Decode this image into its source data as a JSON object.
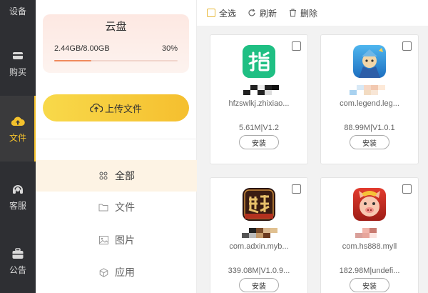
{
  "nav": {
    "items": [
      {
        "label": "设备",
        "icon": "device-icon"
      },
      {
        "label": "购买",
        "icon": "wallet-icon"
      },
      {
        "label": "文件",
        "icon": "cloud-upload-icon",
        "active": true
      },
      {
        "label": "客服",
        "icon": "headset-icon"
      },
      {
        "label": "公告",
        "icon": "briefcase-icon"
      }
    ]
  },
  "cloud": {
    "title": "云盘",
    "usage": "2.44GB/8.00GB",
    "percent_label": "30%",
    "percent": 0.3
  },
  "upload": {
    "label": "上传文件"
  },
  "categories": [
    {
      "label": "全部",
      "icon": "grid-icon",
      "active": true
    },
    {
      "label": "文件",
      "icon": "folder-icon"
    },
    {
      "label": "图片",
      "icon": "image-icon"
    },
    {
      "label": "应用",
      "icon": "app-icon"
    }
  ],
  "toolbar": {
    "select_all": "全选",
    "refresh": "刷新",
    "delete": "删除"
  },
  "files": [
    {
      "package": "hfzswlkj.zhixiao...",
      "meta": "5.61M|V1.2",
      "install": "安装",
      "icon": "zhi-app-icon"
    },
    {
      "package": "com.legend.leg...",
      "meta": "88.99M|V1.0.1",
      "install": "安装",
      "icon": "legend-game-icon"
    },
    {
      "package": "com.adxin.myb...",
      "meta": "339.08M|V1.0.9...",
      "install": "安装",
      "icon": "moyu-game-icon"
    },
    {
      "package": "com.hs888.myll",
      "meta": "182.98M|undefi...",
      "install": "安装",
      "icon": "pig-game-icon"
    }
  ],
  "colors": {
    "accent": "#f3c12c",
    "nav_bg": "#2e2f33",
    "zhi_green": "#1fbf83"
  }
}
